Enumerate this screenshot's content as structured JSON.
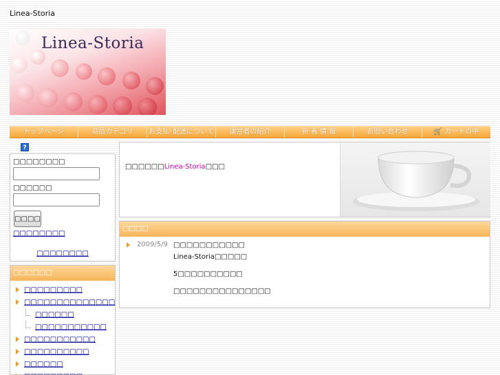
{
  "site": {
    "title": "Linea-Storia",
    "banner_text": "Linea-Storia"
  },
  "nav": {
    "items": [
      "トップページ",
      "商品カテゴリ",
      "お支払･配送について",
      "運営者の紹介",
      "新 着 情 報",
      "お問い合わせ",
      "カートの中"
    ]
  },
  "login": {
    "help_icon": "?",
    "email_label": "□□□□□□□□",
    "password_label": "□□□□□□",
    "login_button": "□□□□",
    "forgot_link": "□□□□□□□□",
    "register_link": "□□□□□□□□"
  },
  "categories": {
    "header": "□□□□□□",
    "items": [
      {
        "label": "□□□□□□□□□",
        "sub": false
      },
      {
        "label": "□□□□□□□□□□□□□□",
        "sub": false
      },
      {
        "label": "□□□□□□",
        "sub": true
      },
      {
        "label": "□□□□□□□□□□□",
        "sub": true
      },
      {
        "label": "□□□□□□□□□□□",
        "sub": false
      },
      {
        "label": "□□□□□□□□□□",
        "sub": false
      },
      {
        "label": "□□□□□□",
        "sub": false
      },
      {
        "label": "□□□□□□□□□",
        "sub": false
      }
    ]
  },
  "welcome": {
    "prefix": "□□□□□□",
    "shop_name": "Linea-Storia",
    "suffix": "□□□"
  },
  "news": {
    "header": "□□□□",
    "date": "2009/5/9",
    "lines": [
      "□□□□□□□□□□□",
      "Linea-Storia□□□□□",
      "5□□□□□□□□□□",
      "□□□□□□□□□□□□□□□"
    ]
  },
  "colors": {
    "accent": "#f6a638",
    "link": "#00009c",
    "shop_name": "#d000b0"
  }
}
